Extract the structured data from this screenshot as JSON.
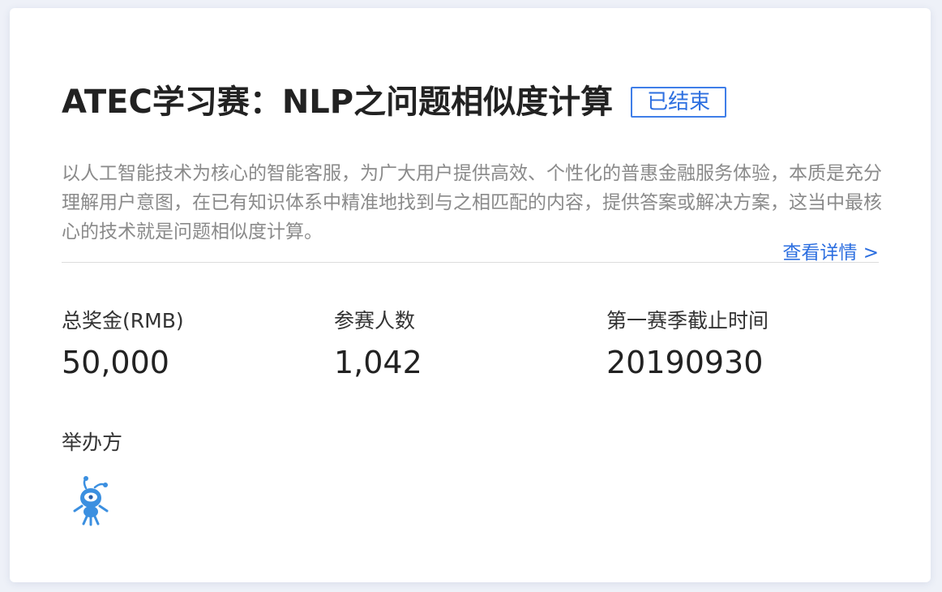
{
  "competition": {
    "title": "ATEC学习赛：NLP之问题相似度计算",
    "status": "已结束",
    "description": "以人工智能技术为核心的智能客服，为广大用户提供高效、个性化的普惠金融服务体验，本质是充分理解用户意图，在已有知识体系中精准地找到与之相匹配的内容，提供答案或解决方案，这当中最核心的技术就是问题相似度计算。",
    "details_link": "查看详情 >"
  },
  "stats": [
    {
      "label": "总奖金(RMB)",
      "value": "50,000"
    },
    {
      "label": "参赛人数",
      "value": "1,042"
    },
    {
      "label": "第一赛季截止时间",
      "value": "20190930"
    }
  ],
  "organizer": {
    "label": "举办方",
    "logo_icon": "ant-mascot-icon"
  },
  "colors": {
    "accent": "#2d6fe0",
    "text_primary": "#222222",
    "text_secondary": "#8a8a8a",
    "background": "#eef1f8",
    "logo_blue": "#3b8fe0"
  }
}
